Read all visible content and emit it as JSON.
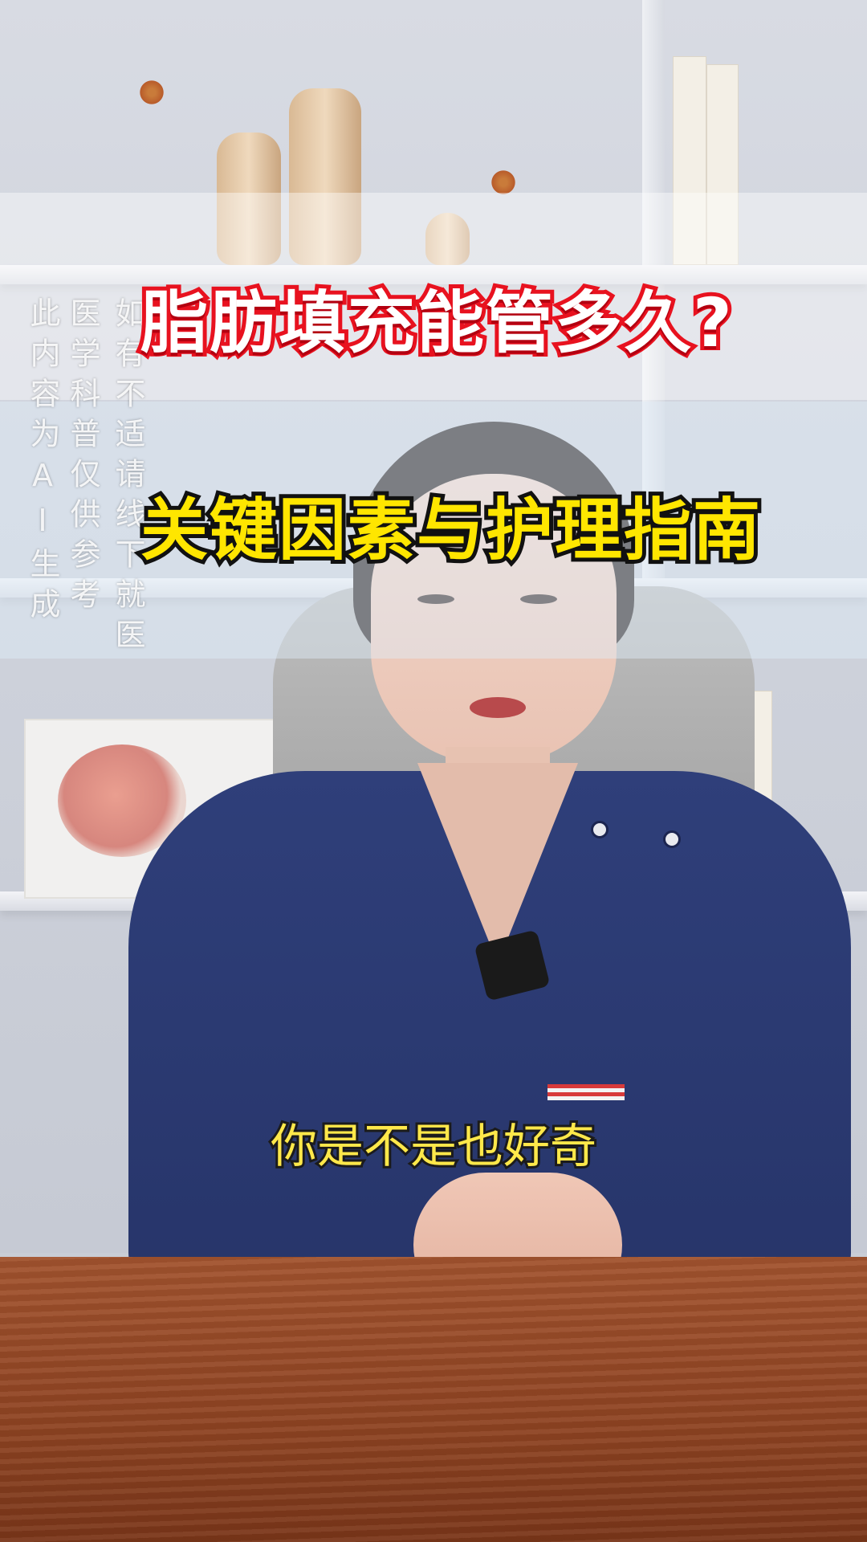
{
  "video": {
    "title_line1": "脂肪填充能管多久?",
    "title_line2": "关键因素与护理指南",
    "subtitle": "你是不是也好奇",
    "disclaimer_columns": [
      "此内容为AI生成",
      "医学科普仅供参考",
      "如有不适请线下就医"
    ]
  },
  "colors": {
    "title1_fill": "#ffffff",
    "title1_outline": "#e8121f",
    "title2_fill": "#ffe600",
    "title2_outline": "#111111",
    "subtitle_fill": "#ffe84a",
    "scrubs": "#2f3f7a"
  }
}
